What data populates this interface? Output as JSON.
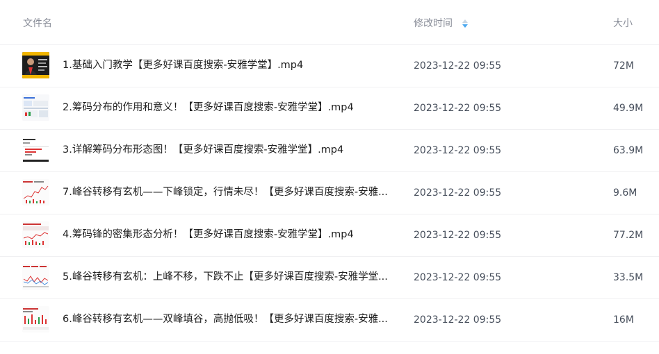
{
  "header": {
    "name_label": "文件名",
    "time_label": "修改时间",
    "size_label": "大小",
    "sort_icon": "sort-arrows-icon",
    "sort_color": "#4aa8f0"
  },
  "rows": [
    {
      "name": "1.基础入门教学【更多好课百度搜索-安雅学堂】.mp4",
      "time": "2023-12-22 09:55",
      "size": "72M",
      "thumb": "video-thumbnail-presenter"
    },
    {
      "name": "2.筹码分布的作用和意义！【更多好课百度搜索-安雅学堂】.mp4",
      "time": "2023-12-22 09:55",
      "size": "49.9M",
      "thumb": "video-thumbnail-chart"
    },
    {
      "name": "3.详解筹码分布形态图！【更多好课百度搜索-安雅学堂】.mp4",
      "time": "2023-12-22 09:55",
      "size": "63.9M",
      "thumb": "video-thumbnail-chart"
    },
    {
      "name": "7.峰谷转移有玄机——下峰锁定，行情未尽！【更多好课百度搜索-安雅...",
      "time": "2023-12-22 09:55",
      "size": "9.6M",
      "thumb": "video-thumbnail-chart"
    },
    {
      "name": "4.筹码锋的密集形态分析！【更多好课百度搜索-安雅学堂】.mp4",
      "time": "2023-12-22 09:55",
      "size": "77.2M",
      "thumb": "video-thumbnail-chart"
    },
    {
      "name": "5.峰谷转移有玄机：上峰不移，下跌不止【更多好课百度搜索-安雅学堂...",
      "time": "2023-12-22 09:55",
      "size": "33.5M",
      "thumb": "video-thumbnail-chart"
    },
    {
      "name": "6.峰谷转移有玄机——双峰填谷，高抛低吸！【更多好课百度搜索-安雅...",
      "time": "2023-12-22 09:55",
      "size": "16M",
      "thumb": "video-thumbnail-chart"
    }
  ]
}
